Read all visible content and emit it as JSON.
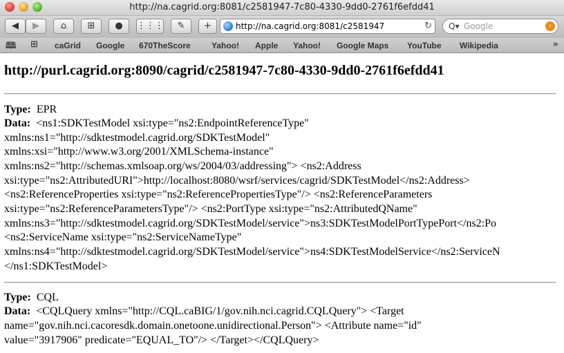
{
  "window": {
    "title": "http://na.cagrid.org:8081/c2581947-7c80-4330-9dd0-2761f6efdd41"
  },
  "toolbar": {
    "url": "http://na.cagrid.org:8081/c2581947",
    "search_placeholder": "Google",
    "plus_label": "+"
  },
  "bookmarks": {
    "items": [
      "caGrid",
      "Google",
      "670TheScore",
      "Yahoo!",
      "Apple",
      "Yahoo!",
      "Google Maps",
      "YouTube",
      "Wikipedia"
    ],
    "more": "»"
  },
  "page": {
    "heading": "http://purl.cagrid.org:8090/cagrid/c2581947-7c80-4330-9dd0-2761f6efdd41",
    "labels": {
      "type": "Type:",
      "data": "Data:"
    },
    "entries": [
      {
        "type": "EPR",
        "data_lines": [
          "<ns1:SDKTestModel xsi:type=\"ns2:EndpointReferenceType\"",
          "xmlns:ns1=\"http://sdktestmodel.cagrid.org/SDKTestModel\"",
          "xmlns:xsi=\"http://www.w3.org/2001/XMLSchema-instance\"",
          "xmlns:ns2=\"http://schemas.xmlsoap.org/ws/2004/03/addressing\"> <ns2:Address",
          "xsi:type=\"ns2:AttributedURI\">http://localhost:8080/wsrf/services/cagrid/SDKTestModel</ns2:Address>",
          "<ns2:ReferenceProperties xsi:type=\"ns2:ReferencePropertiesType\"/> <ns2:ReferenceParameters",
          "xsi:type=\"ns2:ReferenceParametersType\"/> <ns2:PortType xsi:type=\"ns2:AttributedQName\"",
          "xmlns:ns3=\"http://sdktestmodel.cagrid.org/SDKTestModel/service\">ns3:SDKTestModelPortTypePort</ns2:Po",
          "<ns2:ServiceName xsi:type=\"ns2:ServiceNameType\"",
          "xmlns:ns4=\"http://sdktestmodel.cagrid.org/SDKTestModel/service\">ns4:SDKTestModelService</ns2:ServiceN",
          "</ns1:SDKTestModel>"
        ]
      },
      {
        "type": "CQL",
        "data_lines": [
          "<CQLQuery xmlns=\"http://CQL.caBIG/1/gov.nih.nci.cagrid.CQLQuery\"> <Target",
          "name=\"gov.nih.nci.cacoresdk.domain.onetoone.unidirectional.Person\"> <Attribute name=\"id\"",
          "value=\"3917906\" predicate=\"EQUAL_TO\"/> </Target></CQLQuery>"
        ]
      }
    ]
  }
}
